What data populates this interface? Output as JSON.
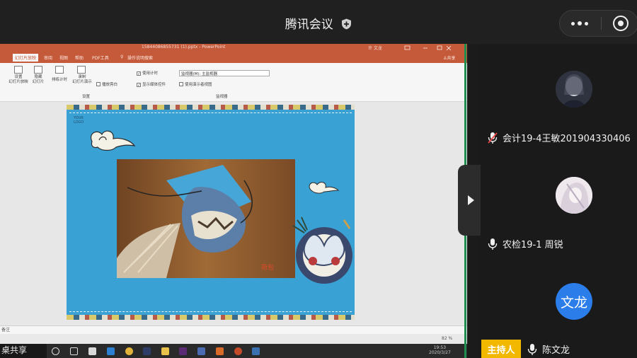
{
  "app": {
    "title": "腾讯会议",
    "share_label": "桌共享"
  },
  "ppt": {
    "window_title": "15844086855731 (1).pptx - PowerPoint",
    "window_user": "许 文龙",
    "tabs": [
      {
        "label": "幻灯片放映",
        "active": true
      },
      {
        "label": "审阅",
        "active": false
      },
      {
        "label": "视图",
        "active": false
      },
      {
        "label": "帮助",
        "active": false
      },
      {
        "label": "PDF工具",
        "active": false
      },
      {
        "label": "操作说明搜索",
        "active": false
      }
    ],
    "share_button": "共享",
    "ribbon": {
      "buttons": [
        {
          "label": "设置\n幻灯片放映"
        },
        {
          "label": "隐藏\n幻灯片"
        },
        {
          "label": "排练计时"
        },
        {
          "label": "录制\n幻灯片演示"
        }
      ],
      "checkboxes": [
        {
          "label": "播放旁白",
          "checked": false
        },
        {
          "label": "使用计时",
          "checked": true
        },
        {
          "label": "显示媒体控件",
          "checked": true
        },
        {
          "label": "使用演示者视图",
          "checked": false
        }
      ],
      "monitor_select": "监视器(M): 主监视器",
      "group_setup": "设置",
      "group_monitor": "监视器"
    },
    "notes_label": "备注",
    "zoom": "82 %",
    "slide": {
      "logo_line1": "YOUR",
      "logo_line2": "LOGO",
      "photo_caption": "荷包"
    }
  },
  "taskbar": {
    "time": "19:53",
    "date": "2020/3/27"
  },
  "participants": [
    {
      "name": "",
      "muted": true,
      "avatar": "photo-dark"
    },
    {
      "name": "会计19-4王敏201904330406",
      "muted": true,
      "avatar": "photo-light"
    },
    {
      "name": "农检19-1 周锐",
      "muted": false,
      "avatar": "text"
    },
    {
      "name": "陈文龙",
      "muted": false,
      "role": "主持人",
      "avatar_text": "文龙"
    }
  ],
  "host_role": "主持人",
  "host_avatar_text": "文龙",
  "colors": {
    "ppt_accent": "#c55a3a",
    "host_badge": "#f2b800",
    "avatar_blue": "#2b7de9",
    "slide_bg": "#3aa1d5",
    "share_border": "#1e8f4e"
  }
}
